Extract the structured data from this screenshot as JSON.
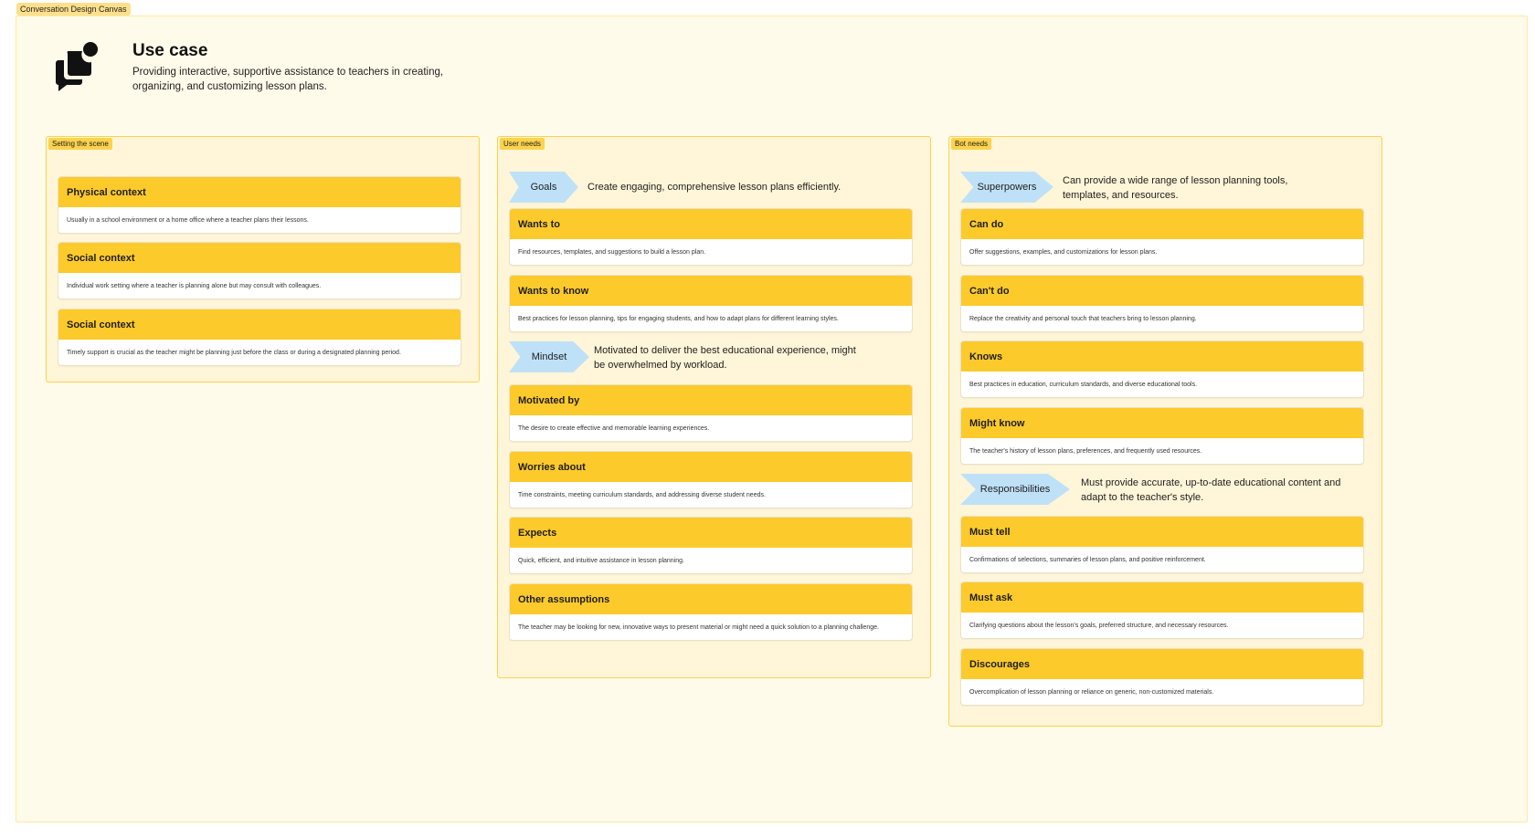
{
  "frame_label": "Conversation Design Canvas",
  "use_case": {
    "title": "Use case",
    "description": "Providing interactive, supportive assistance to teachers in creating, organizing, and customizing lesson plans."
  },
  "setting": {
    "label": "Setting the scene",
    "cards": [
      {
        "title": "Physical context",
        "body": "Usually in a school environment or a home office where a teacher plans their lessons."
      },
      {
        "title": "Social context",
        "body": "Individual work setting where a teacher is planning alone but may consult with colleagues."
      },
      {
        "title": "Social context",
        "body": "Timely support is crucial as the teacher might be planning just before the class or during a designated planning period."
      }
    ]
  },
  "user_needs": {
    "label": "User needs",
    "goals": {
      "label": "Goals",
      "text": "Create engaging, comprehensive lesson plans efficiently."
    },
    "mindset": {
      "label": "Mindset",
      "text": "Motivated to deliver the best educational experience, might be overwhelmed by workload."
    },
    "cards": [
      {
        "title": "Wants to",
        "body": "Find resources, templates, and suggestions to build a lesson plan."
      },
      {
        "title": "Wants to know",
        "body": "Best practices for lesson planning, tips for engaging students, and how to adapt plans for different learning styles."
      },
      {
        "title": "Motivated by",
        "body": "The desire to create effective and memorable learning experiences."
      },
      {
        "title": "Worries about",
        "body": "Time constraints, meeting curriculum standards, and addressing diverse student needs."
      },
      {
        "title": "Expects",
        "body": "Quick, efficient, and intuitive assistance in lesson planning."
      },
      {
        "title": "Other assumptions",
        "body": "The teacher may be looking for new, innovative ways to present material or might need a quick solution to a planning challenge."
      }
    ]
  },
  "bot_needs": {
    "label": "Bot needs",
    "superpowers": {
      "label": "Superpowers",
      "text": "Can provide a wide range of lesson planning tools, templates, and resources."
    },
    "responsibilities": {
      "label": "Responsibilities",
      "text": "Must provide accurate, up-to-date educational content and adapt to the teacher's style."
    },
    "cards": [
      {
        "title": "Can do",
        "body": "Offer suggestions, examples, and customizations for lesson plans."
      },
      {
        "title": "Can't do",
        "body": "Replace the creativity and personal touch that teachers bring to lesson planning."
      },
      {
        "title": "Knows",
        "body": "Best practices in education, curriculum standards, and diverse educational tools."
      },
      {
        "title": "Might know",
        "body": "The teacher's history of lesson plans, preferences, and frequently used resources."
      },
      {
        "title": "Must tell",
        "body": "Confirmations of selections, summaries of lesson plans, and positive reinforcement."
      },
      {
        "title": "Must ask",
        "body": "Clarifying questions about the lesson's goals, preferred structure, and necessary resources."
      },
      {
        "title": "Discourages",
        "body": "Overcomplication of lesson planning or reliance on generic, non-customized materials."
      }
    ]
  },
  "colors": {
    "canvas_bg": "#fffbea",
    "section_bg": "#fff5d8",
    "section_border": "#fcd34d",
    "card_header": "#fdca2b",
    "chevron": "#bfe1f7"
  },
  "icons": {
    "use_case": "chat-bubbles-icon"
  }
}
